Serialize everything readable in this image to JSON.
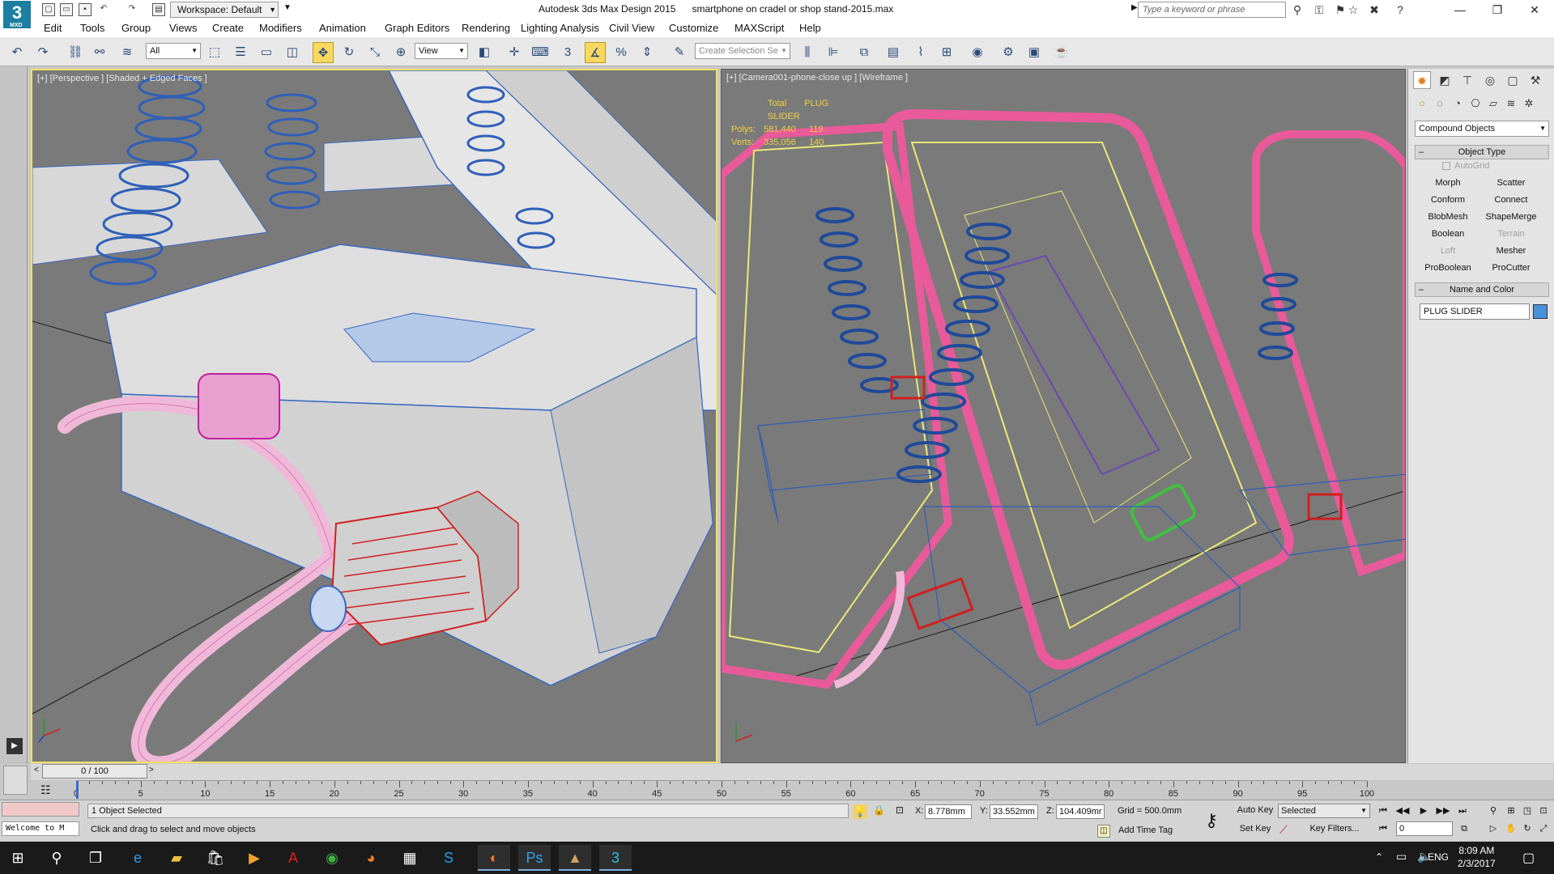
{
  "window": {
    "app_title": "Autodesk 3ds Max Design 2015",
    "file_name": "smartphone on cradel or shop stand-2015.max",
    "workspace_label": "Workspace: Default",
    "search_placeholder": "Type a keyword or phrase",
    "logo_text": "MXD"
  },
  "menu": [
    "Edit",
    "Tools",
    "Group",
    "Views",
    "Create",
    "Modifiers",
    "Animation",
    "Graph Editors",
    "Rendering",
    "Lighting Analysis",
    "Civil View",
    "Customize",
    "MAXScript",
    "Help"
  ],
  "toolbar": {
    "selection_filter": "All",
    "ref_coord": "View",
    "named_selection_placeholder": "Create Selection Se",
    "snap_value": "3"
  },
  "viewports": {
    "left_label": "[+] [Perspective ] [Shaded + Edged Faces ]",
    "right_label": "[+] [Camera001-phone-close up ] [Wireframe ]",
    "stats": {
      "col_total": "Total",
      "col_selected": "PLUG SLIDER",
      "polys_label": "Polys:",
      "polys_total": "581,440",
      "polys_selected": "119",
      "verts_label": "Verts:",
      "verts_total": "335,056",
      "verts_selected": "140"
    }
  },
  "command_panel": {
    "category": "Compound Objects",
    "object_type_title": "Object Type",
    "autogrid_label": "AutoGrid",
    "buttons": [
      {
        "label": "Morph",
        "enabled": true
      },
      {
        "label": "Scatter",
        "enabled": true
      },
      {
        "label": "Conform",
        "enabled": true
      },
      {
        "label": "Connect",
        "enabled": true
      },
      {
        "label": "BlobMesh",
        "enabled": true
      },
      {
        "label": "ShapeMerge",
        "enabled": true
      },
      {
        "label": "Boolean",
        "enabled": true
      },
      {
        "label": "Terrain",
        "enabled": false
      },
      {
        "label": "Loft",
        "enabled": false
      },
      {
        "label": "Mesher",
        "enabled": true
      },
      {
        "label": "ProBoolean",
        "enabled": true
      },
      {
        "label": "ProCutter",
        "enabled": true
      }
    ],
    "name_color_title": "Name and Color",
    "object_name": "PLUG SLIDER",
    "object_color": "#4a90d8"
  },
  "timeline": {
    "slider_label": "0 / 100",
    "current_frame": 0,
    "frame_count": 100,
    "ticks": [
      "0",
      "5",
      "10",
      "15",
      "20",
      "25",
      "30",
      "35",
      "40",
      "45",
      "50",
      "55",
      "60",
      "65",
      "70",
      "75",
      "80",
      "85",
      "90",
      "95",
      "100"
    ]
  },
  "status": {
    "maxscript_listener": "Welcome to M",
    "selection_info": "1 Object Selected",
    "prompt": "Click and drag to select and move objects",
    "x_label": "X:",
    "x_value": "8.778mm",
    "y_label": "Y:",
    "y_value": "33.552mm",
    "z_label": "Z:",
    "z_value": "104.409mr",
    "grid": "Grid = 500.0mm",
    "add_time_tag": "Add Time Tag",
    "auto_key": "Auto Key",
    "set_key": "Set Key",
    "key_mode": "Selected",
    "key_filters": "Key Filters...",
    "frame_field": "0"
  },
  "taskbar": {
    "time": "8:09 AM",
    "date": "2/3/2017",
    "lang": "ENG"
  },
  "colors": {
    "viewport_bg": "#7a7a7a",
    "active_border": "#f0e060",
    "stats_text": "#f0d040",
    "wire_pink": "#e85a9a",
    "wire_blue": "#2f5fb8",
    "wire_yellow": "#e8e878"
  }
}
